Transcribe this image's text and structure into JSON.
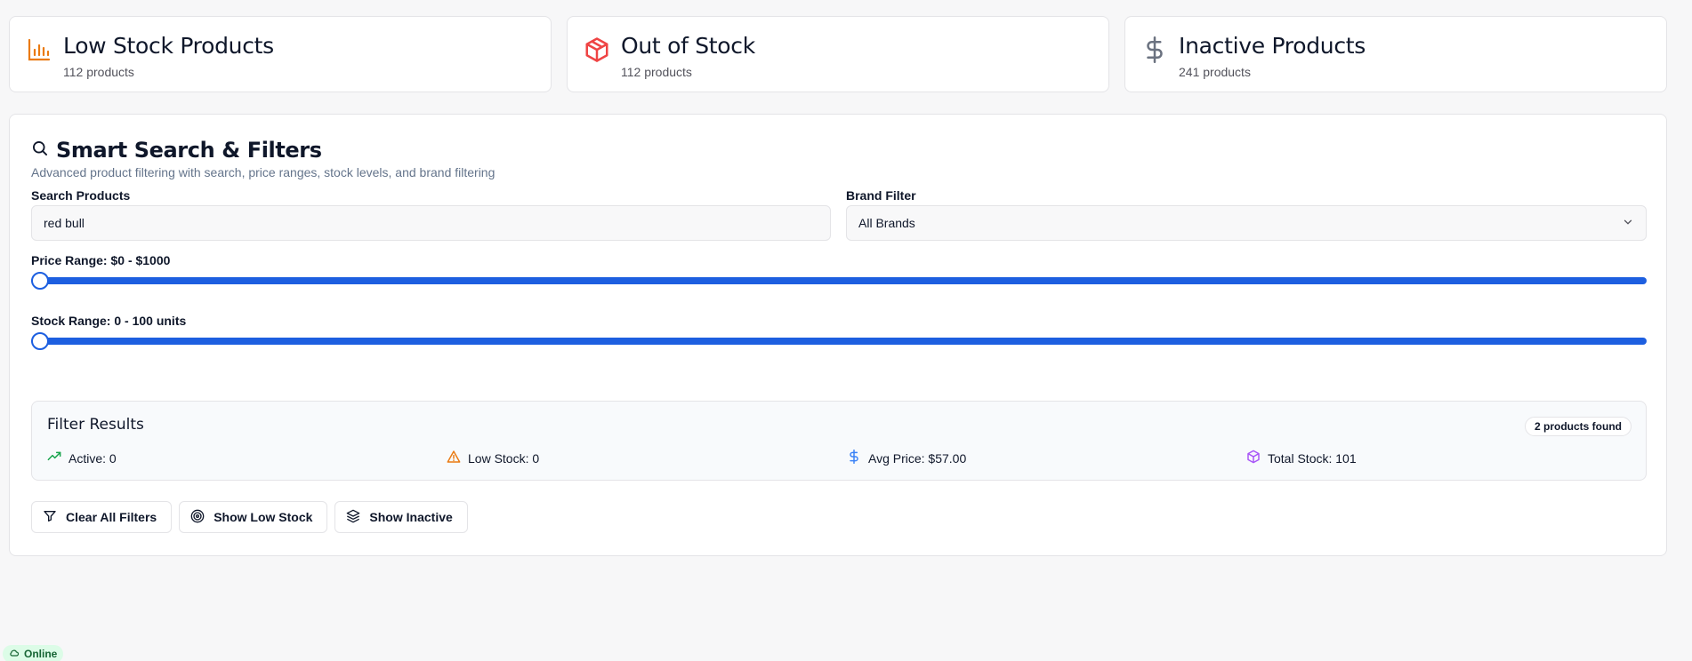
{
  "stats": [
    {
      "title": "Low Stock Products",
      "sub": "112 products",
      "icon": "bar-chart-icon",
      "color": "#ea7a12"
    },
    {
      "title": "Out of Stock",
      "sub": "112 products",
      "icon": "package-icon",
      "color": "#ef4444"
    },
    {
      "title": "Inactive Products",
      "sub": "241 products",
      "icon": "dollar-icon",
      "color": "#6b7280"
    }
  ],
  "panel": {
    "title": "Smart Search & Filters",
    "description": "Advanced product filtering with search, price ranges, stock levels, and brand filtering"
  },
  "search": {
    "label": "Search Products",
    "value": "red bull"
  },
  "brand": {
    "label": "Brand Filter",
    "selected": "All Brands"
  },
  "price": {
    "label": "Price Range: $0 - $1000",
    "min": 0,
    "max": 1000
  },
  "stock": {
    "label": "Stock Range: 0 - 100 units",
    "min": 0,
    "max": 100
  },
  "results": {
    "title": "Filter Results",
    "badge": "2 products found",
    "active": "Active: 0",
    "low_stock": "Low Stock: 0",
    "avg_price": "Avg Price: $57.00",
    "total_stock": "Total Stock: 101"
  },
  "buttons": {
    "clear": "Clear All Filters",
    "low_stock": "Show Low Stock",
    "inactive": "Show Inactive"
  },
  "status": {
    "label": "Online",
    "color": "#166534"
  },
  "colors": {
    "accent": "#1d5fe0",
    "green": "#16a34a",
    "orange": "#ea7a12",
    "blue": "#3b82f6",
    "purple": "#a855f7"
  }
}
